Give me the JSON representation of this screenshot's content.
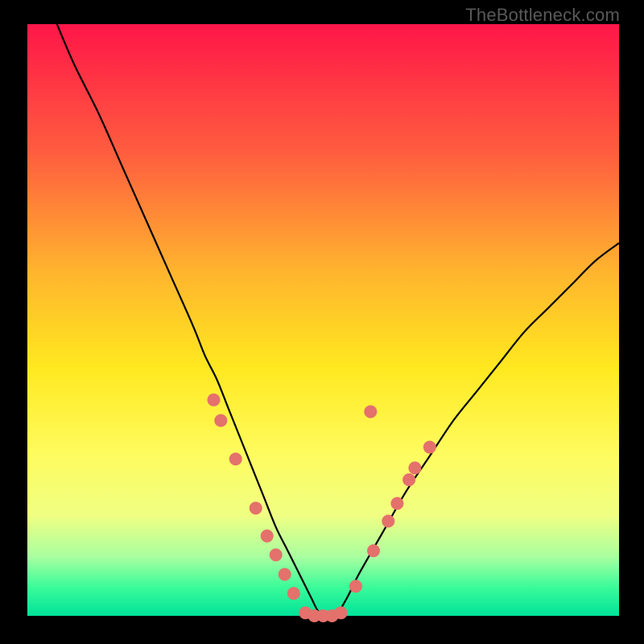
{
  "watermark": "TheBottleneck.com",
  "colors": {
    "frame": "#000000",
    "curve": "#000000",
    "marker_fill": "#e4716b",
    "marker_stroke": "#d96560",
    "gradient_stops": [
      "#ff1648",
      "#ff5e3f",
      "#ffb52e",
      "#ffe81f",
      "#fffb5c",
      "#f0ff82",
      "#a9ffa0",
      "#3efb9a",
      "#00e39a"
    ],
    "gradient_css": "linear-gradient(to bottom, #ff1648 0%, #ff5e3f 22%, #ffb52e 42%, #ffe81f 58%, #fffb5c 72%, #f0ff82 83%, #a9ffa0 90%, #3efb9a 95%, #00e39a 100%)"
  },
  "chart_data": {
    "type": "line",
    "title": "",
    "xlabel": "",
    "ylabel": "",
    "xlim": [
      0,
      100
    ],
    "ylim": [
      0,
      100
    ],
    "grid": false,
    "legend": false,
    "series": [
      {
        "name": "bottleneck-curve",
        "x": [
          5,
          8,
          12,
          16,
          20,
          24,
          28,
          30,
          32,
          34,
          36,
          38,
          40,
          42,
          44,
          46,
          48,
          49,
          50,
          52,
          54,
          56,
          60,
          64,
          68,
          72,
          76,
          80,
          84,
          88,
          92,
          96,
          100
        ],
        "y": [
          100,
          93,
          85,
          76,
          67,
          58,
          49,
          44,
          40,
          35,
          30,
          25,
          20,
          15,
          11,
          7,
          3,
          1,
          0,
          0,
          3,
          7,
          14,
          21,
          27,
          33,
          38,
          43,
          48,
          52,
          56,
          60,
          63
        ]
      }
    ],
    "markers": [
      {
        "x": 31.5,
        "y": 36.5
      },
      {
        "x": 32.7,
        "y": 33.0
      },
      {
        "x": 35.2,
        "y": 26.5
      },
      {
        "x": 38.6,
        "y": 18.2
      },
      {
        "x": 40.5,
        "y": 13.5
      },
      {
        "x": 42.0,
        "y": 10.3
      },
      {
        "x": 43.5,
        "y": 7.0
      },
      {
        "x": 45.0,
        "y": 3.8
      },
      {
        "x": 47.0,
        "y": 0.5
      },
      {
        "x": 48.5,
        "y": 0.0
      },
      {
        "x": 50.0,
        "y": 0.0
      },
      {
        "x": 51.5,
        "y": 0.0
      },
      {
        "x": 53.0,
        "y": 0.5
      },
      {
        "x": 55.5,
        "y": 5.0
      },
      {
        "x": 58.5,
        "y": 11.0
      },
      {
        "x": 61.0,
        "y": 16.0
      },
      {
        "x": 62.5,
        "y": 19.0
      },
      {
        "x": 64.5,
        "y": 23.0
      },
      {
        "x": 65.5,
        "y": 25.0
      },
      {
        "x": 68.0,
        "y": 28.5
      },
      {
        "x": 58.0,
        "y": 34.5
      }
    ],
    "marker_radius_px": 8
  }
}
